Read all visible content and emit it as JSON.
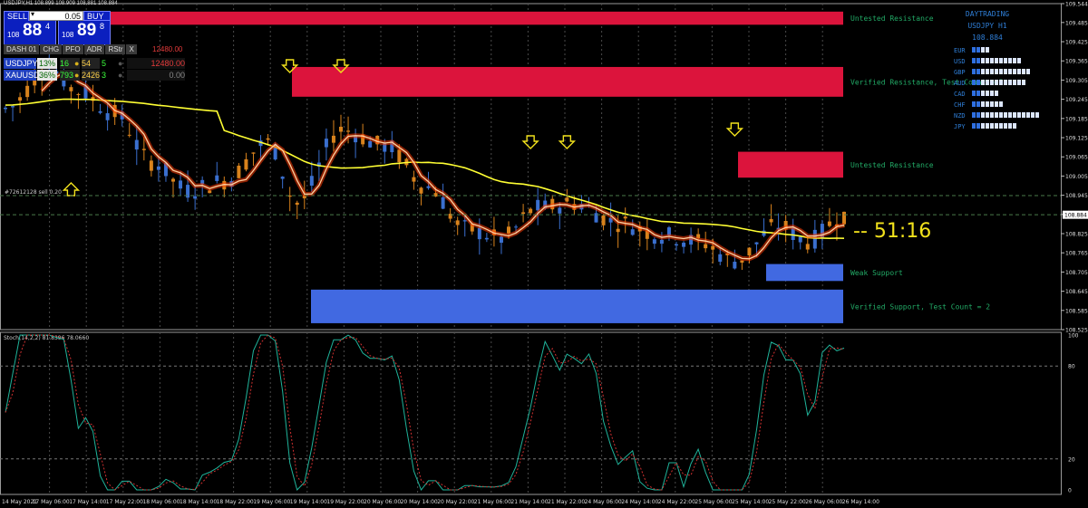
{
  "window": {
    "header_text": "USDJPY,H1 108.899 108.909 108.881 108.884"
  },
  "trade_panel": {
    "sell_label": "SELL",
    "buy_label": "BUY",
    "lot": "0.05",
    "sell_prefix": "108",
    "sell_big": "88",
    "sell_sup": "4",
    "buy_prefix": "108",
    "buy_big": "89",
    "buy_sup": "8"
  },
  "dashboard": {
    "tabs": [
      "DASH 01",
      "CHG",
      "PFO",
      "ADR",
      "RStr",
      "X"
    ],
    "total_profit": "12480.00",
    "rows": [
      {
        "symbol": "USDJPY",
        "pct": "13%",
        "v1": "16",
        "v2": "54",
        "v3": "5",
        "profit": "12480.00"
      },
      {
        "symbol": "XAUUSD",
        "pct": "36%",
        "v1": "793",
        "v2": "2426",
        "v3": "3",
        "profit": "0.00"
      }
    ]
  },
  "order_line_label": "#72612128 sell 0.20",
  "countdown": "-- 51:16",
  "colors": {
    "resistance": "#dc143c",
    "support": "#4169e1",
    "ma_yellow": "#ffff33",
    "zone_text": "#22aa66",
    "bull": "#3a6fcf",
    "bear": "#d8821c",
    "arrow": "#f2e21c"
  },
  "zones": [
    {
      "type": "resistance",
      "label": "Untested Resistance",
      "top": 109.519,
      "bottom": 109.478
    },
    {
      "type": "resistance",
      "label": "Verified Resistance, Test Count = 3",
      "top": 109.346,
      "bottom": 109.253
    },
    {
      "type": "resistance",
      "label": "Untested Resistance",
      "top": 109.081,
      "bottom": 109.0
    },
    {
      "type": "support",
      "label": "Weak Support",
      "top": 108.73,
      "bottom": 108.677
    },
    {
      "type": "support",
      "label": "Verified Support, Test Count = 2",
      "top": 108.65,
      "bottom": 108.545
    }
  ],
  "strength_panel": {
    "title": "DAYTRADING",
    "subtitle": "USDJPY H1",
    "price": "108.884",
    "currencies": [
      {
        "code": "EUR",
        "bars": 4
      },
      {
        "code": "USD",
        "bars": 11
      },
      {
        "code": "GBP",
        "bars": 13
      },
      {
        "code": "AUD",
        "bars": 12
      },
      {
        "code": "CAD",
        "bars": 6
      },
      {
        "code": "CHF",
        "bars": 7
      },
      {
        "code": "NZD",
        "bars": 15
      },
      {
        "code": "JPY",
        "bars": 10
      }
    ]
  },
  "stoch_label": "Stoch(14,2,2) 81.8396 78.0660",
  "price_axis": {
    "ticks": [
      "109.544",
      "109.485",
      "109.425",
      "109.365",
      "109.305",
      "109.245",
      "109.185",
      "109.125",
      "109.065",
      "109.005",
      "108.945",
      "108.885",
      "108.825",
      "108.765",
      "108.705",
      "108.645",
      "108.585",
      "108.525"
    ],
    "current": "108.884"
  },
  "stoch_axis": [
    "100",
    "80",
    "20",
    "0"
  ],
  "time_axis": [
    "14 May 2021",
    "17 May 06:00",
    "17 May 14:00",
    "17 May 22:00",
    "18 May 06:00",
    "18 May 14:00",
    "18 May 22:00",
    "19 May 06:00",
    "19 May 14:00",
    "19 May 22:00",
    "20 May 06:00",
    "20 May 14:00",
    "20 May 22:00",
    "21 May 06:00",
    "21 May 14:00",
    "21 May 22:00",
    "24 May 06:00",
    "24 May 14:00",
    "24 May 22:00",
    "25 May 06:00",
    "25 May 14:00",
    "25 May 22:00",
    "26 May 06:00",
    "26 May 14:00"
  ],
  "arrows": [
    {
      "dir": "down",
      "candle": 39
    },
    {
      "dir": "down",
      "candle": 46
    },
    {
      "dir": "down",
      "candle": 72
    },
    {
      "dir": "down",
      "candle": 77
    },
    {
      "dir": "down",
      "candle": 100
    },
    {
      "dir": "up",
      "candle": 9
    }
  ]
}
